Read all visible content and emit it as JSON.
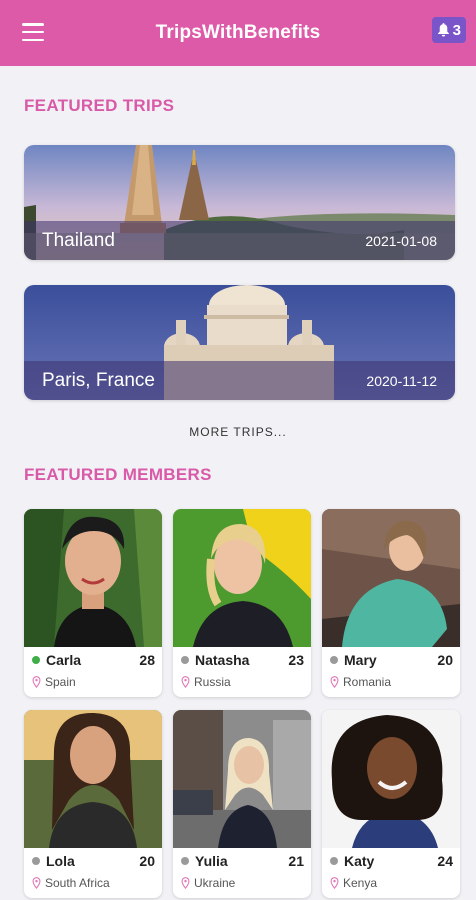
{
  "app": {
    "title": "TripsWithBenefits",
    "notification_count": "3"
  },
  "colors": {
    "header": "#dd5aa8",
    "accent": "#d85aa8",
    "badge": "#7a55c9",
    "online": "#3fae49",
    "offline": "#9a9a9a"
  },
  "sections": {
    "featured_trips": "FEATURED TRIPS",
    "featured_members": "FEATURED MEMBERS",
    "more_trips": "MORE TRIPS..."
  },
  "trips": [
    {
      "name": "Thailand",
      "date": "2021-01-08"
    },
    {
      "name": "Paris, France",
      "date": "2020-11-12"
    }
  ],
  "members": [
    {
      "name": "Carla",
      "age": "28",
      "country": "Spain",
      "status": "online"
    },
    {
      "name": "Natasha",
      "age": "23",
      "country": "Russia",
      "status": "offline"
    },
    {
      "name": "Mary",
      "age": "20",
      "country": "Romania",
      "status": "offline"
    },
    {
      "name": "Lola",
      "age": "20",
      "country": "South Africa",
      "status": "offline"
    },
    {
      "name": "Yulia",
      "age": "21",
      "country": "Ukraine",
      "status": "offline"
    },
    {
      "name": "Katy",
      "age": "24",
      "country": "Kenya",
      "status": "offline"
    }
  ]
}
